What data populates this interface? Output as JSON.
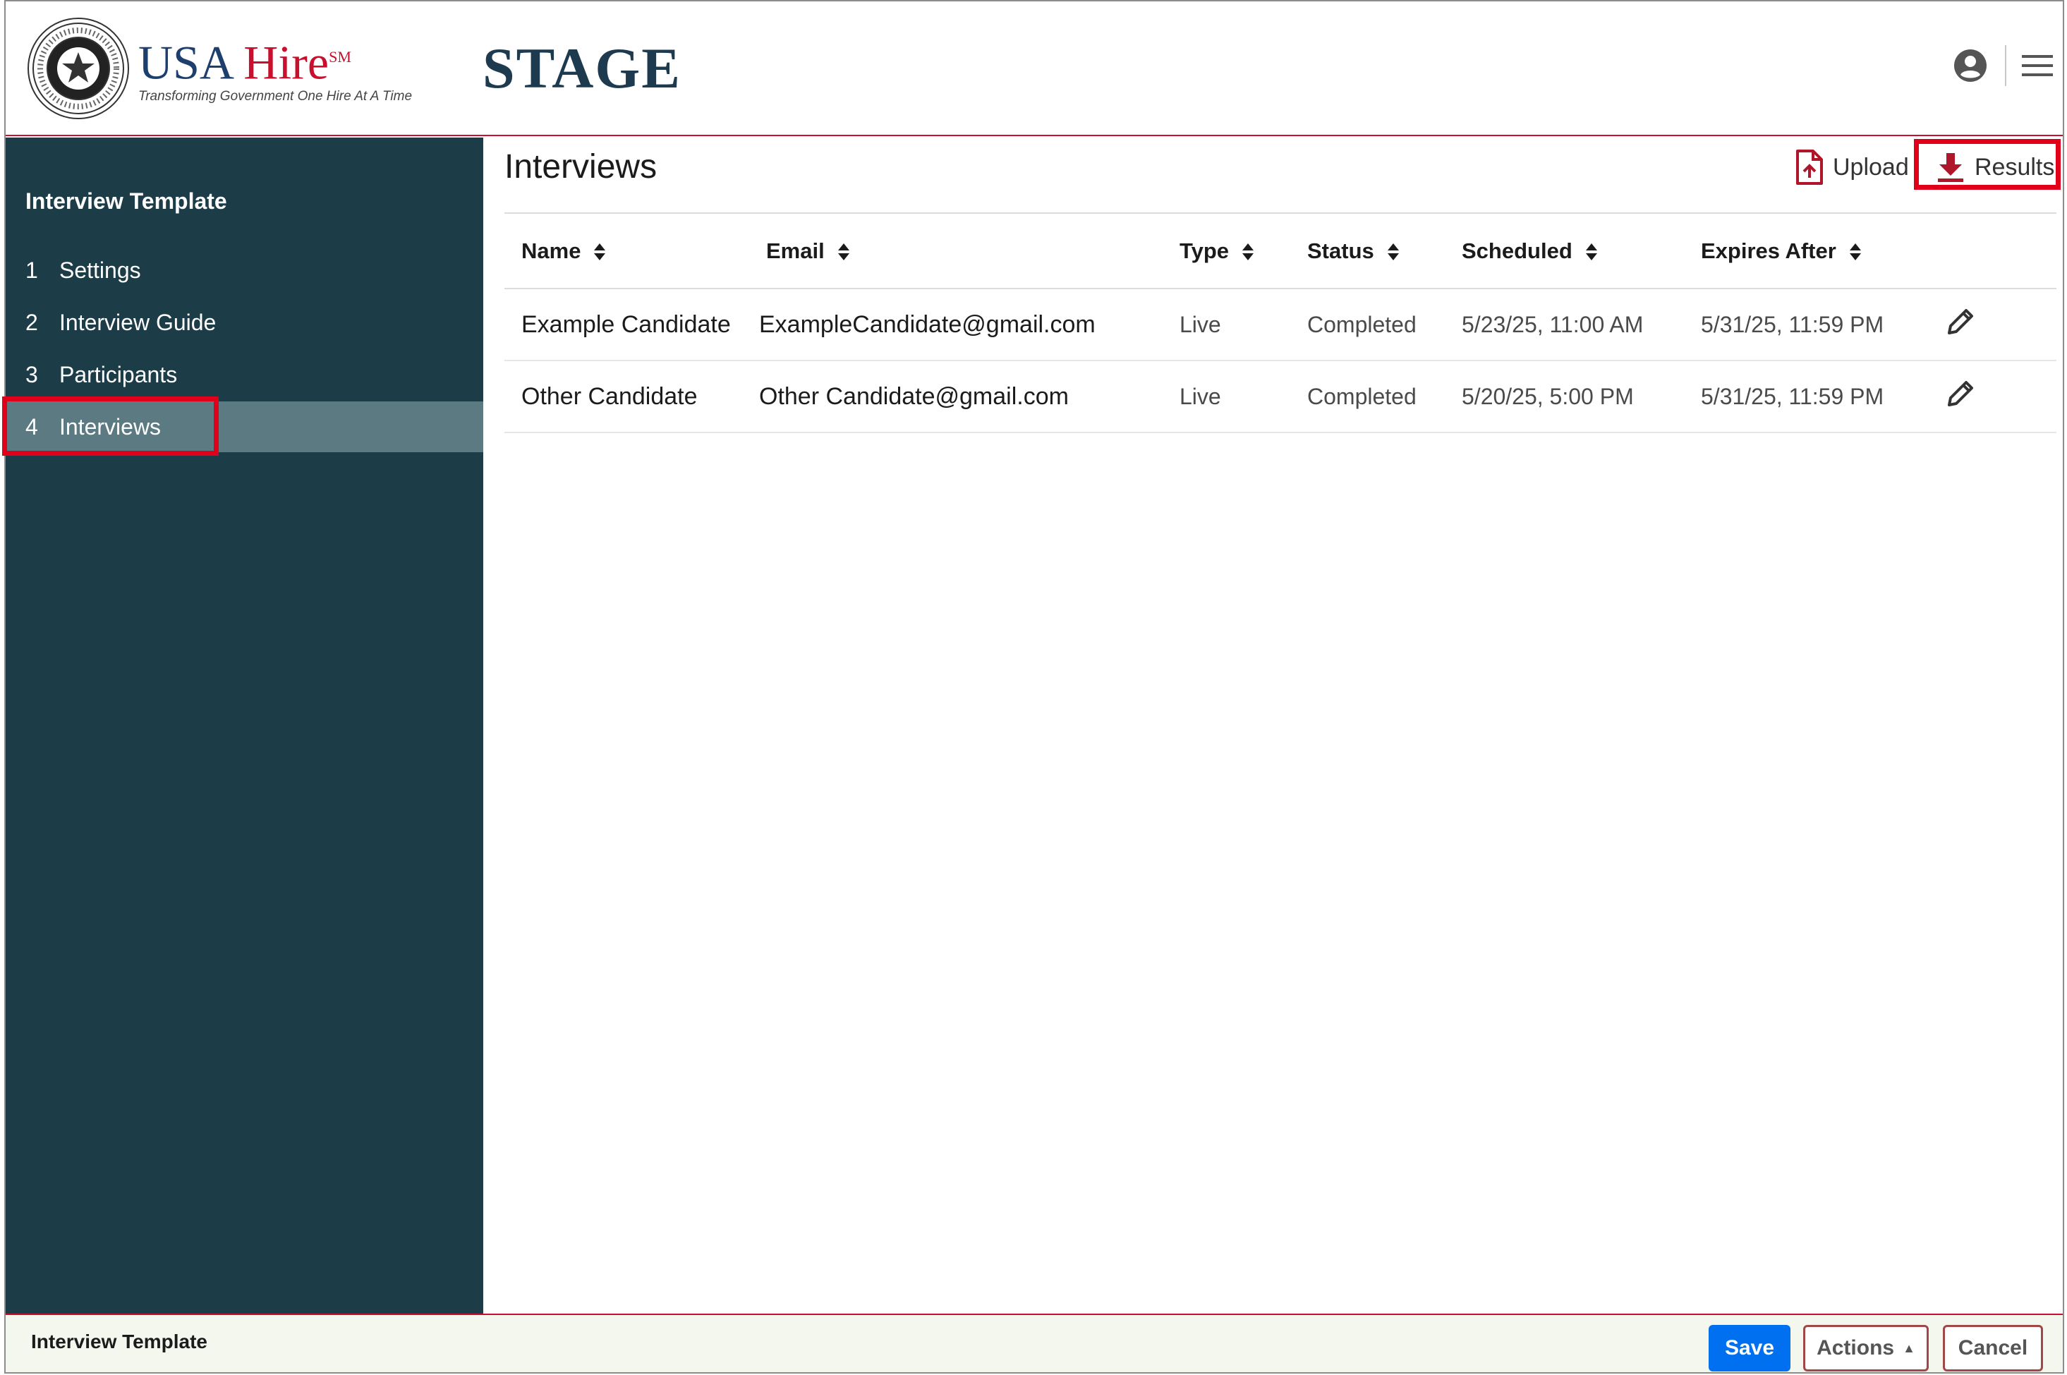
{
  "header": {
    "logo": {
      "name_part1": "USA ",
      "name_part2": "Hire",
      "superscript": "SM",
      "tagline": "Transforming Government One Hire At A Time",
      "seal_text": "UNITED STATES OFFICE OF PERSONNEL MANAGEMENT"
    },
    "environment": "STAGE"
  },
  "sidebar": {
    "title": "Interview Template",
    "items": [
      {
        "num": "1",
        "label": "Settings",
        "active": false
      },
      {
        "num": "2",
        "label": "Interview Guide",
        "active": false
      },
      {
        "num": "3",
        "label": "Participants",
        "active": false
      },
      {
        "num": "4",
        "label": "Interviews",
        "active": true
      }
    ]
  },
  "main": {
    "title": "Interviews",
    "toolbar": {
      "upload_label": "Upload",
      "results_label": "Results"
    },
    "table": {
      "columns": [
        "Name",
        "Email",
        "Type",
        "Status",
        "Scheduled",
        "Expires After"
      ],
      "rows": [
        {
          "name": "Example Candidate",
          "email": "ExampleCandidate@gmail.com",
          "type": "Live",
          "status": "Completed",
          "scheduled": "5/23/25, 11:00 AM",
          "expires": "5/31/25, 11:59 PM"
        },
        {
          "name": "Other Candidate",
          "email": "Other Candidate@gmail.com",
          "type": "Live",
          "status": "Completed",
          "scheduled": "5/20/25, 5:00 PM",
          "expires": "5/31/25, 11:59 PM"
        }
      ]
    }
  },
  "footer": {
    "label": "Interview Template",
    "save_label": "Save",
    "actions_label": "Actions",
    "cancel_label": "Cancel"
  },
  "colors": {
    "sidebar_bg": "#1c3c48",
    "active_item_bg": "#5c7a81",
    "accent_red": "#c8102e",
    "highlight_red": "#e0001a",
    "save_blue": "#0070f0"
  },
  "icons": [
    "opm-seal",
    "user-icon",
    "menu-icon",
    "upload-file-icon",
    "download-icon",
    "sort-icon",
    "pencil-icon"
  ]
}
